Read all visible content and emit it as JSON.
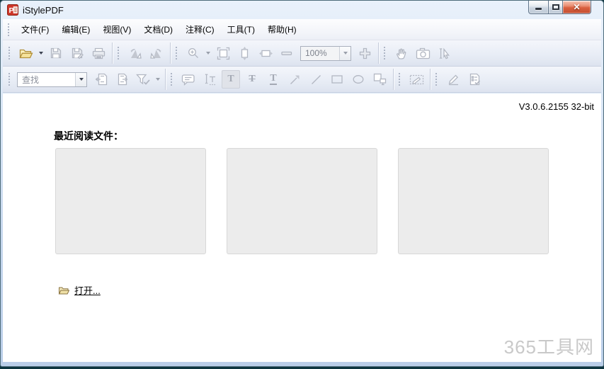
{
  "window": {
    "title": "iStylePDF",
    "logo_letter": "P",
    "close_glyph": "✕"
  },
  "menu": {
    "items": [
      {
        "label": "文件(F)"
      },
      {
        "label": "编辑(E)"
      },
      {
        "label": "视图(V)"
      },
      {
        "label": "文档(D)"
      },
      {
        "label": "注释(C)"
      },
      {
        "label": "工具(T)"
      },
      {
        "label": "帮助(H)"
      }
    ]
  },
  "toolbar_main": {
    "zoom_value": "100%",
    "icons": [
      "open-folder-icon",
      "open-dropdown-icon",
      "save-icon",
      "save-as-icon",
      "print-icon",
      "rotate-left-icon",
      "rotate-right-icon",
      "zoom-in-tool-icon",
      "zoom-dropdown-icon",
      "fit-page-icon",
      "fit-height-icon",
      "fit-width-icon",
      "zoom-out-icon",
      "zoom-level-combobox",
      "zoom-in-icon",
      "hand-tool-icon",
      "snapshot-icon",
      "select-tool-icon"
    ]
  },
  "toolbar_find": {
    "find_value": "查找",
    "glyphs": {
      "highlight": "T",
      "strikeout": "T",
      "underline": "T"
    },
    "icons": [
      "find-combobox",
      "find-previous-icon",
      "find-next-icon",
      "filter-check-icon",
      "filter-dropdown-icon",
      "note-comment-icon",
      "text-select-icon",
      "highlight-text-icon",
      "strikeout-text-icon",
      "underline-text-icon",
      "arrow-annotation-icon",
      "line-annotation-icon",
      "rectangle-annotation-icon",
      "ellipse-annotation-icon",
      "media-annotation-icon",
      "signature-field-icon",
      "sign-pencil-icon",
      "form-verify-icon"
    ]
  },
  "content": {
    "version": "V3.0.6.2155 32-bit",
    "recent_heading": "最近阅读文件：",
    "open_label": "打开...",
    "recent_slot_count": 3
  },
  "watermark": "365工具网",
  "colors": {
    "titlebar_frame": "#c3d5ec",
    "toolbar_bg": "#e6ebf5",
    "close_button": "#d0573c",
    "placeholder_bg": "#ececec",
    "placeholder_border": "#d8d8d8",
    "watermark_text": "#c9c9c9"
  }
}
